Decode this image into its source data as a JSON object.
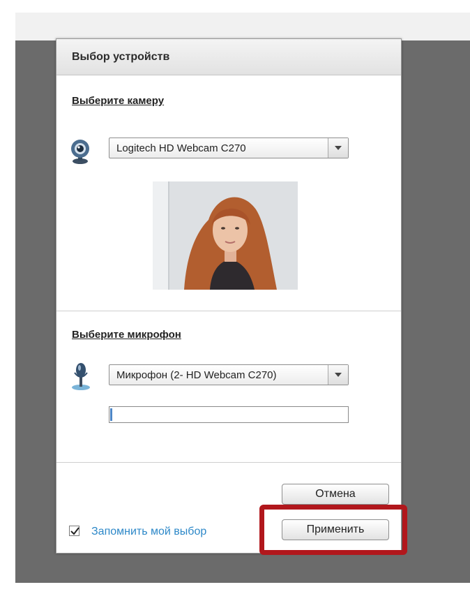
{
  "dialog": {
    "title": "Выбор устройств",
    "camera": {
      "section_title": "Выберите камеру",
      "selected": "Logitech HD Webcam C270",
      "icon": "webcam-icon"
    },
    "microphone": {
      "section_title": "Выберите микрофон",
      "selected": "Микрофон (2- HD Webcam C270)",
      "icon": "microphone-icon",
      "level": 0.01
    },
    "remember": {
      "checked": true,
      "label": "Запомнить мой выбор"
    },
    "buttons": {
      "cancel": "Отмена",
      "apply": "Применить"
    },
    "highlight_color": "#b1171c",
    "link_color": "#2d88c8"
  }
}
